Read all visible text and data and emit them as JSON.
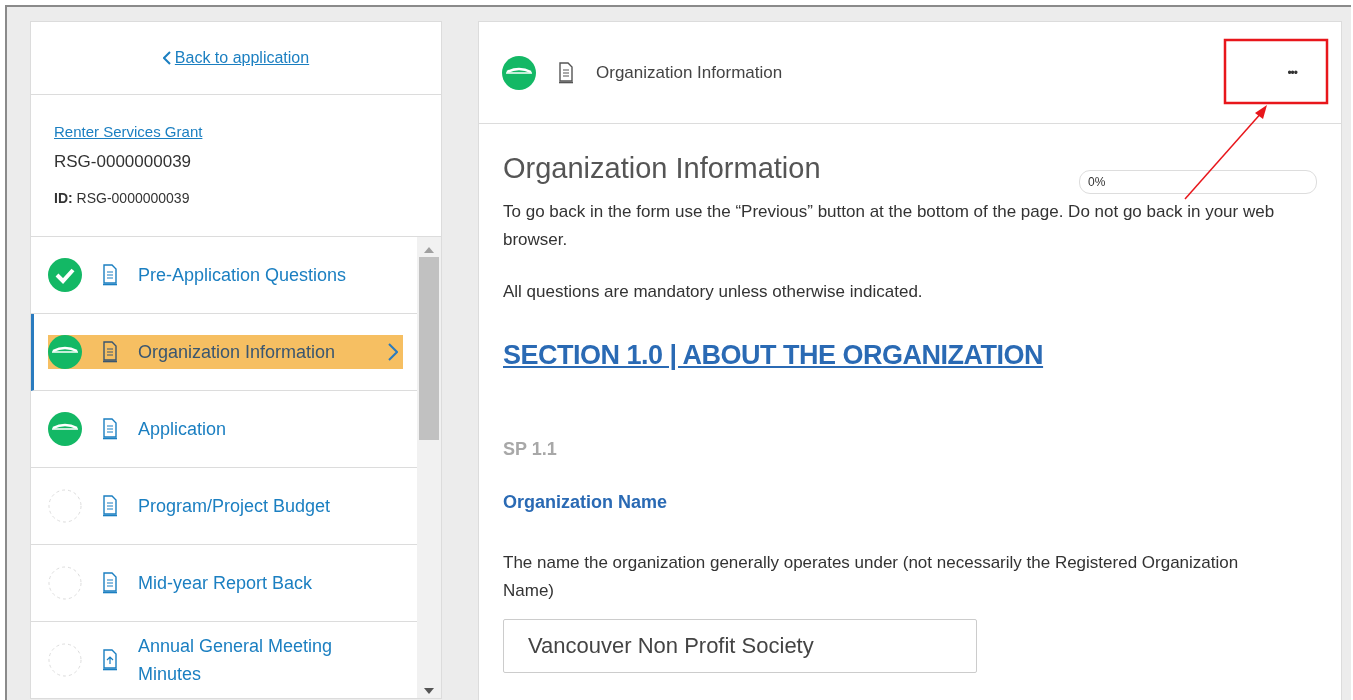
{
  "sidebar": {
    "back_link": "Back to application",
    "program_link": "Renter Services Grant",
    "reference": "RSG-0000000039",
    "id_label": "ID:",
    "id_value": "RSG-0000000039",
    "items": [
      {
        "label": "Pre-Application Questions",
        "kind": "form",
        "started": true,
        "complete": true,
        "selected": false
      },
      {
        "label": "Organization Information",
        "kind": "form",
        "started": true,
        "complete": false,
        "selected": true
      },
      {
        "label": "Application",
        "kind": "form",
        "started": true,
        "complete": false,
        "selected": false
      },
      {
        "label": "Program/Project Budget",
        "kind": "form",
        "started": false,
        "complete": false,
        "selected": false
      },
      {
        "label": "Mid-year Report Back",
        "kind": "form",
        "started": false,
        "complete": false,
        "selected": false
      },
      {
        "label": "Annual General Meeting Minutes",
        "kind": "upload",
        "started": false,
        "complete": false,
        "selected": false
      }
    ]
  },
  "header": {
    "started": true,
    "complete": false,
    "title": "Organization Information",
    "more": "•••"
  },
  "form": {
    "title": "Organization Information",
    "progress": {
      "level": 0,
      "reading": "0%"
    },
    "intro": "To go back in the form use the “Previous” button at the bottom of the page. Do not go back in your web browser.",
    "note": "All questions are mandatory unless otherwise indicated.",
    "section": "SECTION 1.0 | ABOUT THE ORGANIZATION",
    "code": "SP 1.1",
    "question": "Organization Name",
    "help": "The name the organization generally operates under (not necessarily the Registered Organization Name)",
    "answer": "Vancouver Non Profit Society"
  }
}
